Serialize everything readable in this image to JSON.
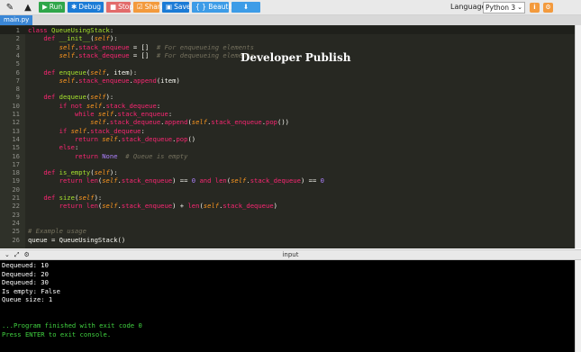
{
  "toolbar": {
    "buttons": {
      "run": "Run",
      "debug": "Debug",
      "stop": "Stop",
      "share": "Share",
      "save": "Save",
      "beautify": "{ } Beautify"
    },
    "language_label": "Language",
    "language_value": "Python 3"
  },
  "file_tab": "main.py",
  "overlay_text": "Developer Publish",
  "input_bar_label": "input",
  "code_lines": [
    {
      "n": "1",
      "html": "<span class=\"kw\">class</span> <span class=\"fn\">QueueUsingStack</span>:"
    },
    {
      "n": "2",
      "html": "    <span class=\"kw\">def</span> <span class=\"fn\">__init__</span>(<span class=\"self\">self</span>):"
    },
    {
      "n": "3",
      "html": "        <span class=\"self\">self</span>.<span class=\"kw\">stack_enqueue</span> = []  <span class=\"cm\"># For enqueueing elements</span>"
    },
    {
      "n": "4",
      "html": "        <span class=\"self\">self</span>.<span class=\"kw\">stack_dequeue</span> = []  <span class=\"cm\"># For dequeueing elements</span>"
    },
    {
      "n": "5",
      "html": ""
    },
    {
      "n": "6",
      "html": "    <span class=\"kw\">def</span> <span class=\"fn\">enqueue</span>(<span class=\"self\">self</span>, item):"
    },
    {
      "n": "7",
      "html": "        <span class=\"self\">self</span>.<span class=\"kw\">stack_enqueue</span>.<span class=\"kw\">append</span>(item)"
    },
    {
      "n": "8",
      "html": ""
    },
    {
      "n": "9",
      "html": "    <span class=\"kw\">def</span> <span class=\"fn\">dequeue</span>(<span class=\"self\">self</span>):"
    },
    {
      "n": "10",
      "html": "        <span class=\"kw\">if not</span> <span class=\"self\">self</span>.<span class=\"kw\">stack_dequeue</span>:"
    },
    {
      "n": "11",
      "html": "            <span class=\"kw\">while</span> <span class=\"self\">self</span>.<span class=\"kw\">stack_enqueue</span>:"
    },
    {
      "n": "12",
      "html": "                <span class=\"self\">self</span>.<span class=\"kw\">stack_dequeue</span>.<span class=\"kw\">append</span>(<span class=\"self\">self</span>.<span class=\"kw\">stack_enqueue</span>.<span class=\"kw\">pop</span>())"
    },
    {
      "n": "13",
      "html": "        <span class=\"kw\">if</span> <span class=\"self\">self</span>.<span class=\"kw\">stack_dequeue</span>:"
    },
    {
      "n": "14",
      "html": "            <span class=\"kw\">return</span> <span class=\"self\">self</span>.<span class=\"kw\">stack_dequeue</span>.<span class=\"kw\">pop</span>()"
    },
    {
      "n": "15",
      "html": "        <span class=\"kw\">else</span>:"
    },
    {
      "n": "16",
      "html": "            <span class=\"kw\">return</span> <span class=\"num\">None</span>  <span class=\"cm\"># Queue is empty</span>"
    },
    {
      "n": "17",
      "html": ""
    },
    {
      "n": "18",
      "html": "    <span class=\"kw\">def</span> <span class=\"fn\">is_empty</span>(<span class=\"self\">self</span>):"
    },
    {
      "n": "19",
      "html": "        <span class=\"kw\">return</span> <span class=\"kw\">len</span>(<span class=\"self\">self</span>.<span class=\"kw\">stack_enqueue</span>) == <span class=\"num\">0</span> <span class=\"kw\">and</span> <span class=\"kw\">len</span>(<span class=\"self\">self</span>.<span class=\"kw\">stack_dequeue</span>) == <span class=\"num\">0</span>"
    },
    {
      "n": "20",
      "html": ""
    },
    {
      "n": "21",
      "html": "    <span class=\"kw\">def</span> <span class=\"fn\">size</span>(<span class=\"self\">self</span>):"
    },
    {
      "n": "22",
      "html": "        <span class=\"kw\">return</span> <span class=\"kw\">len</span>(<span class=\"self\">self</span>.<span class=\"kw\">stack_enqueue</span>) + <span class=\"kw\">len</span>(<span class=\"self\">self</span>.<span class=\"kw\">stack_dequeue</span>)"
    },
    {
      "n": "23",
      "html": ""
    },
    {
      "n": "24",
      "html": ""
    },
    {
      "n": "25",
      "html": "<span class=\"cm\"># Example usage</span>"
    },
    {
      "n": "26",
      "html": "queue = QueueUsingStack()"
    }
  ],
  "console_lines": [
    {
      "text": "Dequeued: 10",
      "green": false
    },
    {
      "text": "Dequeued: 20",
      "green": false
    },
    {
      "text": "Dequeued: 30",
      "green": false
    },
    {
      "text": "Is empty: False",
      "green": false
    },
    {
      "text": "Queue size: 1",
      "green": false
    },
    {
      "text": "",
      "green": false
    },
    {
      "text": "",
      "green": false
    },
    {
      "text": "...Program finished with exit code 0",
      "green": true
    },
    {
      "text": "Press ENTER to exit console.",
      "green": true
    }
  ]
}
